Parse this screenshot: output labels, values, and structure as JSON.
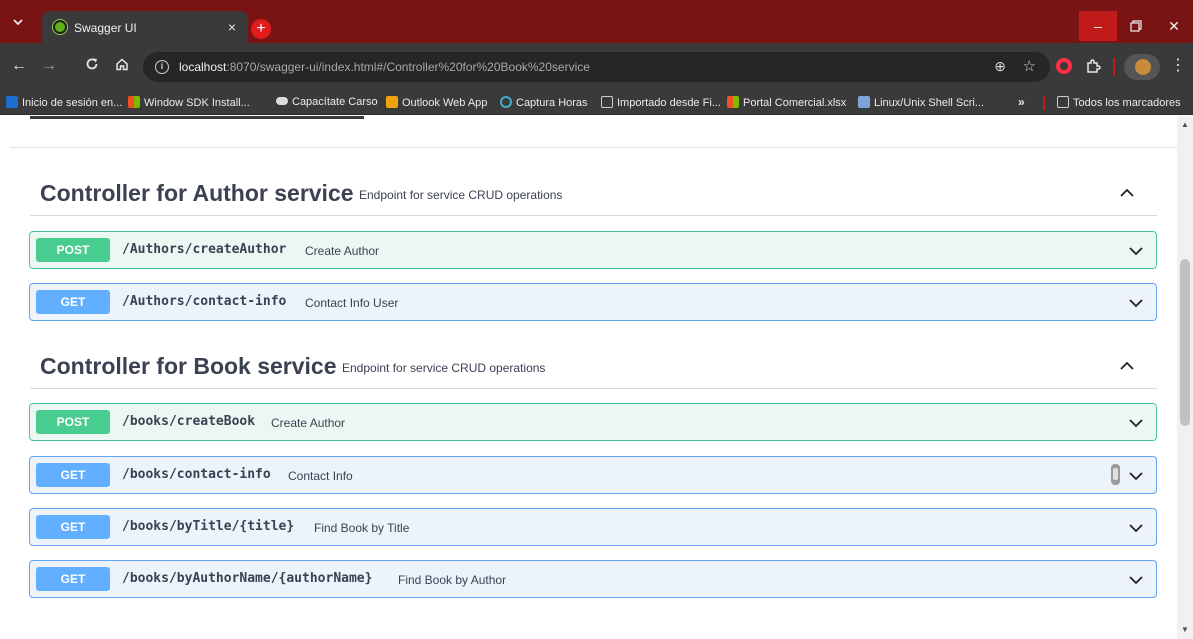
{
  "browser": {
    "tab_title": "Swagger UI",
    "tab_close": "×",
    "new_tab": "+",
    "url_host": "localhost",
    "url_rest": ":8070/swagger-ui/index.html#/Controller%20for%20Book%20service",
    "bookmarks": [
      {
        "label": "Inicio de sesión en...",
        "icon": "z-logo-icon",
        "color": "#1a6fd0"
      },
      {
        "label": "Window SDK Install...",
        "icon": "windows-icon",
        "color": "#f25022"
      },
      {
        "label": "Capacítate Carso",
        "icon": "cloud-icon",
        "color": "#dddddd"
      },
      {
        "label": "Outlook Web App",
        "icon": "outlook-icon",
        "color": "#f0a30a"
      },
      {
        "label": "Captura Horas",
        "icon": "clock-icon",
        "color": "#3fb0c9"
      },
      {
        "label": "Importado desde Fi...",
        "icon": "folder-icon",
        "color": "#cccccc"
      },
      {
        "label": "Portal Comercial.xlsx",
        "icon": "windows-icon",
        "color": "#f25022"
      },
      {
        "label": "Linux/Unix Shell Scri...",
        "icon": "document-icon",
        "color": "#7ea3d8"
      }
    ],
    "bookmarks_overflow": "»",
    "all_bookmarks": "Todos los marcadores"
  },
  "sections": [
    {
      "title": "Controller for Author service",
      "description": "Endpoint for service CRUD operations",
      "operations": [
        {
          "method": "POST",
          "path": "/Authors/createAuthor",
          "summary": "Create Author"
        },
        {
          "method": "GET",
          "path": "/Authors/contact-info",
          "summary": "Contact Info User"
        }
      ]
    },
    {
      "title": "Controller for Book service",
      "description": "Endpoint for service CRUD operations",
      "operations": [
        {
          "method": "POST",
          "path": "/books/createBook",
          "summary": "Create Author"
        },
        {
          "method": "GET",
          "path": "/books/contact-info",
          "summary": "Contact Info"
        },
        {
          "method": "GET",
          "path": "/books/byTitle/{title}",
          "summary": "Find Book by Title"
        },
        {
          "method": "GET",
          "path": "/books/byAuthorName/{authorName}",
          "summary": "Find Book by Author"
        }
      ]
    }
  ],
  "colors": {
    "post": "#49cc90",
    "get": "#61affe",
    "title_text": "#3b4151",
    "browser_frame": "#7a1414"
  }
}
